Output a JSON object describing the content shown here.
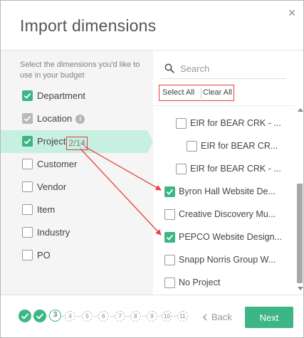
{
  "dialog": {
    "title": "Import dimensions",
    "close_glyph": "×"
  },
  "left_panel": {
    "instructions": "Select the dimensions you'd like to use in your budget",
    "dimensions": [
      {
        "label": "Department",
        "state": "checked",
        "active": false,
        "info": false,
        "count": ""
      },
      {
        "label": "Location",
        "state": "disabled-checked",
        "active": false,
        "info": true,
        "count": ""
      },
      {
        "label": "Project",
        "state": "checked",
        "active": true,
        "info": false,
        "count": "2/14"
      },
      {
        "label": "Customer",
        "state": "unchecked",
        "active": false,
        "info": false,
        "count": ""
      },
      {
        "label": "Vendor",
        "state": "unchecked",
        "active": false,
        "info": false,
        "count": ""
      },
      {
        "label": "Item",
        "state": "unchecked",
        "active": false,
        "info": false,
        "count": ""
      },
      {
        "label": "Industry",
        "state": "unchecked",
        "active": false,
        "info": false,
        "count": ""
      },
      {
        "label": "PO",
        "state": "unchecked",
        "active": false,
        "info": false,
        "count": ""
      }
    ],
    "info_glyph": "i"
  },
  "right_panel": {
    "search_placeholder": "Search",
    "select_all": "Select All",
    "clear_all": "Clear All",
    "items": [
      {
        "label": "EIR for BEAR CRK - ...",
        "checked": false,
        "indent": 1
      },
      {
        "label": "EIR for BEAR CR...",
        "checked": false,
        "indent": 2
      },
      {
        "label": "EIR for BEAR CRK - ...",
        "checked": false,
        "indent": 1
      },
      {
        "label": "Byron Hall Website De...",
        "checked": true,
        "indent": 0
      },
      {
        "label": "Creative Discovery Mu...",
        "checked": false,
        "indent": 0
      },
      {
        "label": "PEPCO Website Design...",
        "checked": true,
        "indent": 0
      },
      {
        "label": "Snapp Norris Group W...",
        "checked": false,
        "indent": 0
      },
      {
        "label": "No Project",
        "checked": false,
        "indent": 0
      }
    ]
  },
  "footer": {
    "steps": [
      {
        "label": "",
        "status": "done"
      },
      {
        "label": "",
        "status": "done"
      },
      {
        "label": "3",
        "status": "current"
      },
      {
        "label": "4",
        "status": "todo"
      },
      {
        "label": "5",
        "status": "todo"
      },
      {
        "label": "6",
        "status": "todo"
      },
      {
        "label": "7",
        "status": "todo"
      },
      {
        "label": "8",
        "status": "todo"
      },
      {
        "label": "9",
        "status": "todo"
      },
      {
        "label": "10",
        "status": "todo"
      },
      {
        "label": "11",
        "status": "todo"
      }
    ],
    "back_label": "Back",
    "next_label": "Next"
  },
  "colors": {
    "accent": "#3cb685",
    "active_row": "#c7efe2",
    "annotation": "#e8403f"
  }
}
